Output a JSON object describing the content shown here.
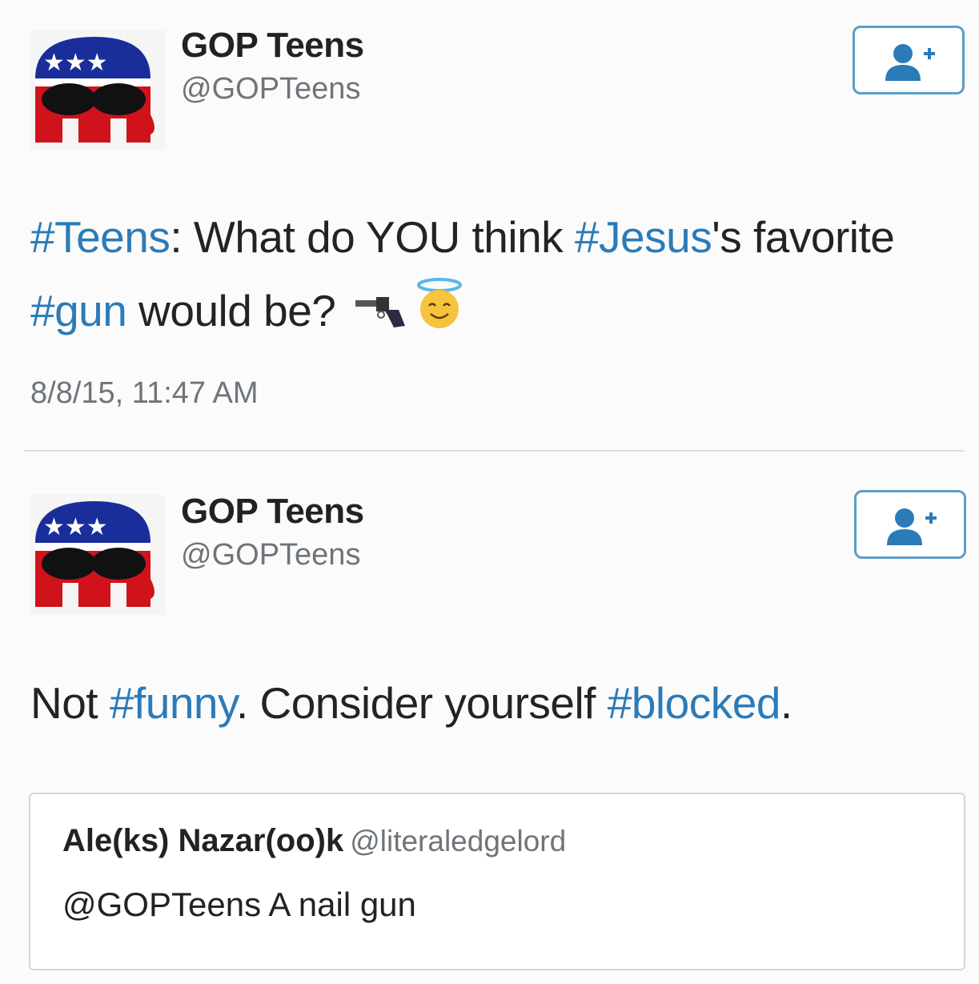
{
  "tweets": [
    {
      "author": {
        "name": "GOP Teens",
        "handle": "@GOPTeens"
      },
      "text_parts": [
        {
          "type": "hashtag",
          "text": "#Teens"
        },
        {
          "type": "text",
          "text": ": What do YOU think "
        },
        {
          "type": "hashtag",
          "text": "#Jesus"
        },
        {
          "type": "text",
          "text": "'s favorite "
        },
        {
          "type": "hashtag",
          "text": "#gun"
        },
        {
          "type": "text",
          "text": " would be?"
        }
      ],
      "emojis": [
        "pistol-icon",
        "smiling-face-with-halo-icon"
      ],
      "timestamp": "8/8/15, 11:47 AM"
    },
    {
      "author": {
        "name": "GOP Teens",
        "handle": "@GOPTeens"
      },
      "text_parts": [
        {
          "type": "text",
          "text": "Not "
        },
        {
          "type": "hashtag",
          "text": "#funny"
        },
        {
          "type": "text",
          "text": ". Consider yourself "
        },
        {
          "type": "hashtag",
          "text": "#blocked"
        },
        {
          "type": "text",
          "text": "."
        }
      ],
      "quoted": {
        "name": "Ale(ks) Nazar(oo)k",
        "handle": "@literaledgelord",
        "text": "@GOPTeens A nail gun"
      }
    }
  ],
  "colors": {
    "hashtag": "#2b7bb9",
    "follow_border": "#5b9ec9",
    "follow_icon": "#2b7bb9",
    "logo_blue": "#1a2e9b",
    "logo_red": "#d0121b"
  }
}
